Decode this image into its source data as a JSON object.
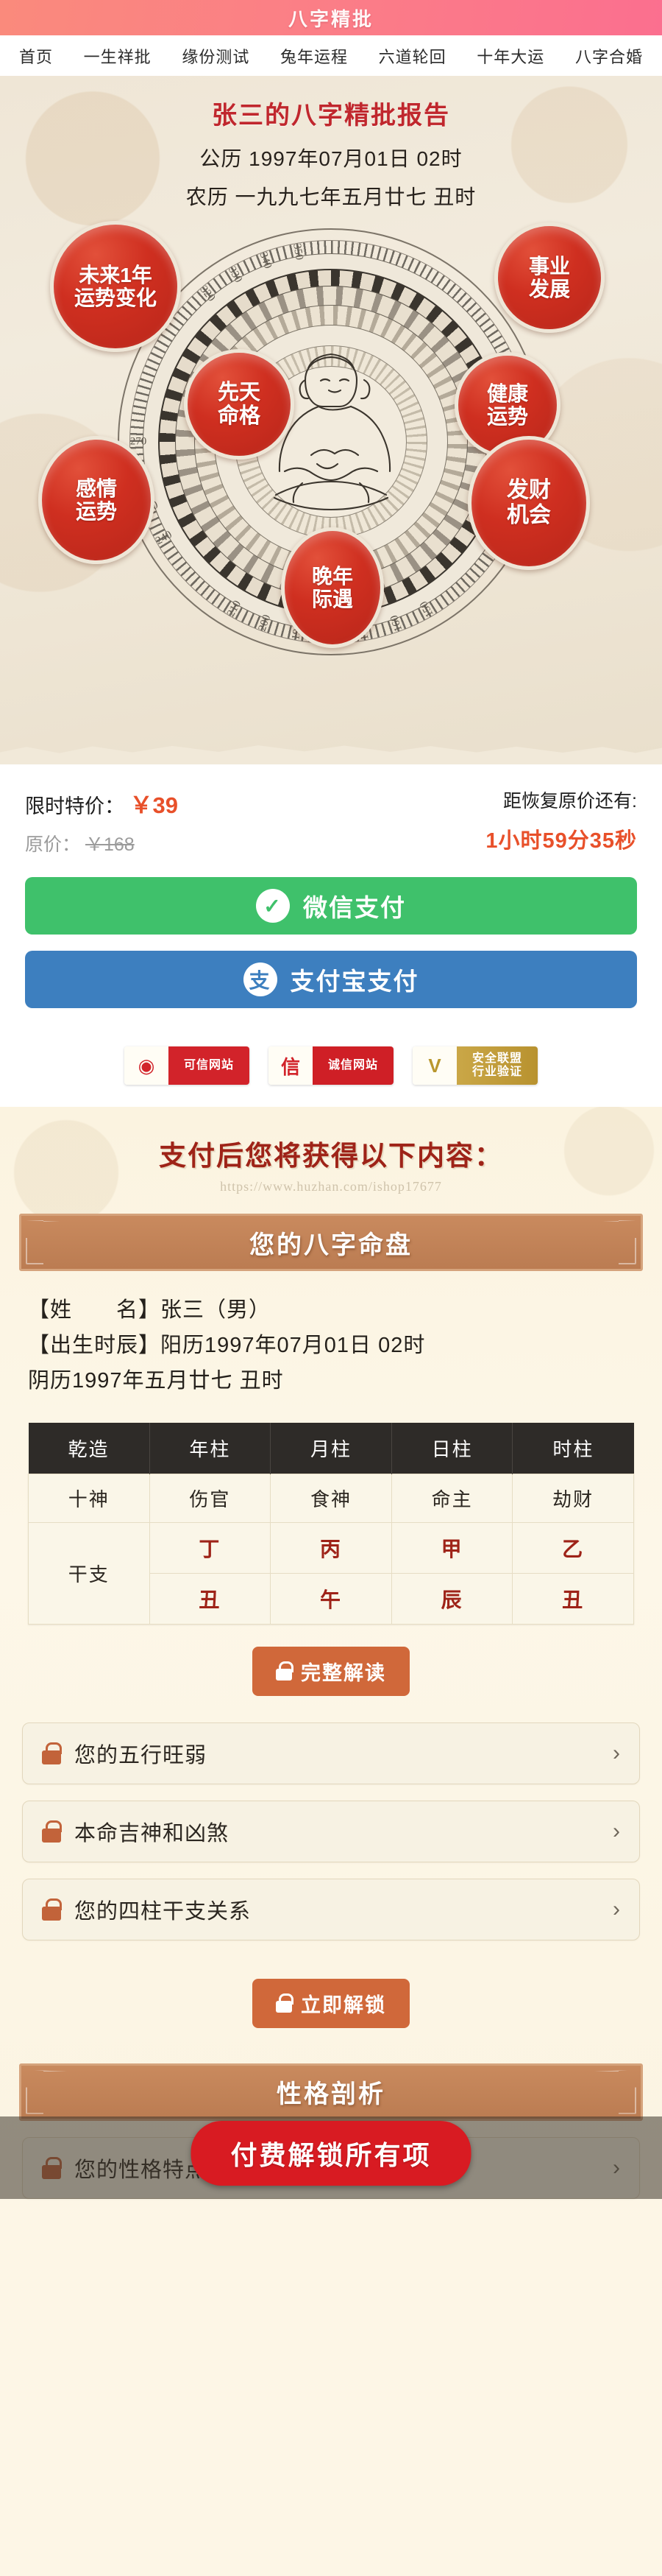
{
  "header": {
    "title": "八字精批"
  },
  "nav": {
    "items": [
      "首页",
      "一生祥批",
      "缘份测试",
      "兔年运程",
      "六道轮回",
      "十年大运",
      "八字合婚"
    ]
  },
  "hero": {
    "title": "张三的八字精批报告",
    "solar_line": "公历 1997年07月01日  02时",
    "lunar_line": "农历 一九九七年五月廿七 丑时",
    "bubbles": [
      {
        "name": "future-fortune",
        "label": "未来1年\n运势变化"
      },
      {
        "name": "career",
        "label": "事业\n发展"
      },
      {
        "name": "innate-destiny",
        "label": "先天\n命格"
      },
      {
        "name": "health",
        "label": "健康\n运势"
      },
      {
        "name": "love",
        "label": "感情\n运势"
      },
      {
        "name": "wealth",
        "label": "发财\n机会"
      },
      {
        "name": "later-years",
        "label": "晚年\n际遇"
      }
    ],
    "degree_ticks": [
      "90",
      "100",
      "110",
      "150",
      "160",
      "170",
      "190",
      "200",
      "210",
      "240",
      "250",
      "260",
      "270",
      "320",
      "330",
      "340",
      "350"
    ]
  },
  "pricing": {
    "special_label": "限时特价：",
    "special_amount": "￥39",
    "original_label": "原价：",
    "original_amount": "￥168",
    "countdown_label": "距恢复原价还有:",
    "countdown_value": "1小时59分35秒",
    "accent_color": "#e8502a"
  },
  "payment": {
    "wechat_label": "微信支付",
    "wechat_icon": "check-bubble-icon",
    "wechat_color": "#3fc16b",
    "alipay_label": "支付宝支付",
    "alipay_icon": "alipay-zhi-icon",
    "alipay_color": "#3d7fbf"
  },
  "badges": [
    {
      "name": "trusted-site-badge",
      "mark": "◉",
      "line1": "可信网站",
      "line2": ""
    },
    {
      "name": "honest-site-badge",
      "mark": "信",
      "line1": "诚信网站",
      "line2": ""
    },
    {
      "name": "security-union-badge",
      "mark": "V",
      "line1": "安全联盟",
      "line2": "行业验证"
    }
  ],
  "content": {
    "heading": "支付后您将获得以下内容：",
    "watermark": "https://www.huzhan.com/ishop17677",
    "panel_title": "您的八字命盘",
    "info_lines": [
      "【姓　　名】张三（男）",
      "【出生时辰】阳历1997年07月01日  02时",
      "阴历1997年五月廿七 丑时"
    ],
    "full_reading_button": "完整解读",
    "unlock_now_button": "立即解锁",
    "second_panel_title": "性格剖析",
    "cta_button": "付费解锁所有项",
    "lock_icon": "lock-icon",
    "chevron_icon": "chevron-right-icon"
  },
  "bazi_table": {
    "headers": [
      "乾造",
      "年柱",
      "月柱",
      "日柱",
      "时柱"
    ],
    "rows": [
      {
        "label": "十神",
        "values": [
          "伤官",
          "食神",
          "命主",
          "劫财"
        ]
      },
      {
        "label": "干支",
        "stems": [
          "丁",
          "丙",
          "甲",
          "乙"
        ],
        "branches": [
          "丑",
          "午",
          "辰",
          "丑"
        ]
      }
    ]
  },
  "locked_items": [
    {
      "name": "wuxing-strength",
      "label": "您的五行旺弱"
    },
    {
      "name": "auspicious-stars",
      "label": "本命吉神和凶煞"
    },
    {
      "name": "four-pillars",
      "label": "您的四柱干支关系"
    },
    {
      "name": "personality",
      "label": "您的性格特点"
    }
  ]
}
